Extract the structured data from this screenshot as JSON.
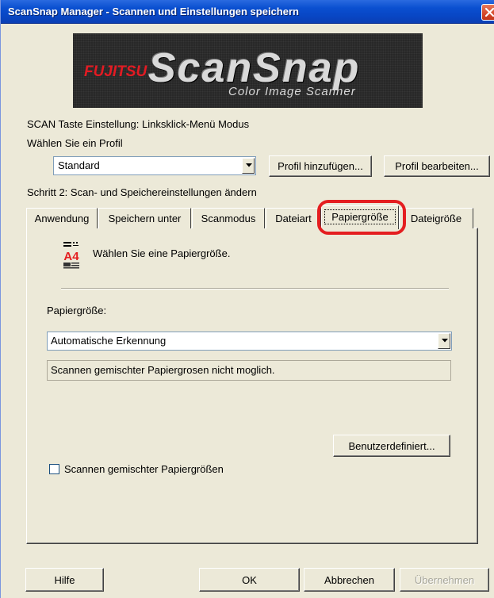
{
  "window": {
    "title": "ScanSnap Manager - Scannen und Einstellungen speichern"
  },
  "banner": {
    "fujitsu": "FUJITSU",
    "brand": "ScanSnap",
    "tagline": "Color Image Scanner"
  },
  "scan_button_setting": "SCAN Taste Einstellung: Linksklick-Menü Modus",
  "profile": {
    "label": "Wählen Sie ein Profil",
    "selected": "Standard",
    "add_button": "Profil hinzufügen...",
    "edit_button": "Profil bearbeiten..."
  },
  "step_label": "Schritt 2: Scan- und Speichereinstellungen ändern",
  "tabs": [
    {
      "label": "Anwendung"
    },
    {
      "label": "Speichern unter"
    },
    {
      "label": "Scanmodus"
    },
    {
      "label": "Dateiart"
    },
    {
      "label": "Papiergröße"
    },
    {
      "label": "Dateigröße"
    }
  ],
  "active_tab": "Papiergröße",
  "highlight_color": "#e41e20",
  "paper_tab": {
    "icon_text": "A4",
    "instruction": "Wählen Sie eine Papiergröße.",
    "paper_size_label": "Papiergröße:",
    "paper_size_selected": "Automatische Erkennung",
    "info_text": "Scannen gemischter Papiergrosen nicht moglich.",
    "custom_button": "Benutzerdefiniert...",
    "mixed_checkbox_label": "Scannen gemischter Papiergrößen",
    "mixed_checkbox_checked": false
  },
  "footer": {
    "help_button": "Hilfe",
    "ok_button": "OK",
    "cancel_button": "Abbrechen",
    "apply_button": "Übernehmen"
  }
}
